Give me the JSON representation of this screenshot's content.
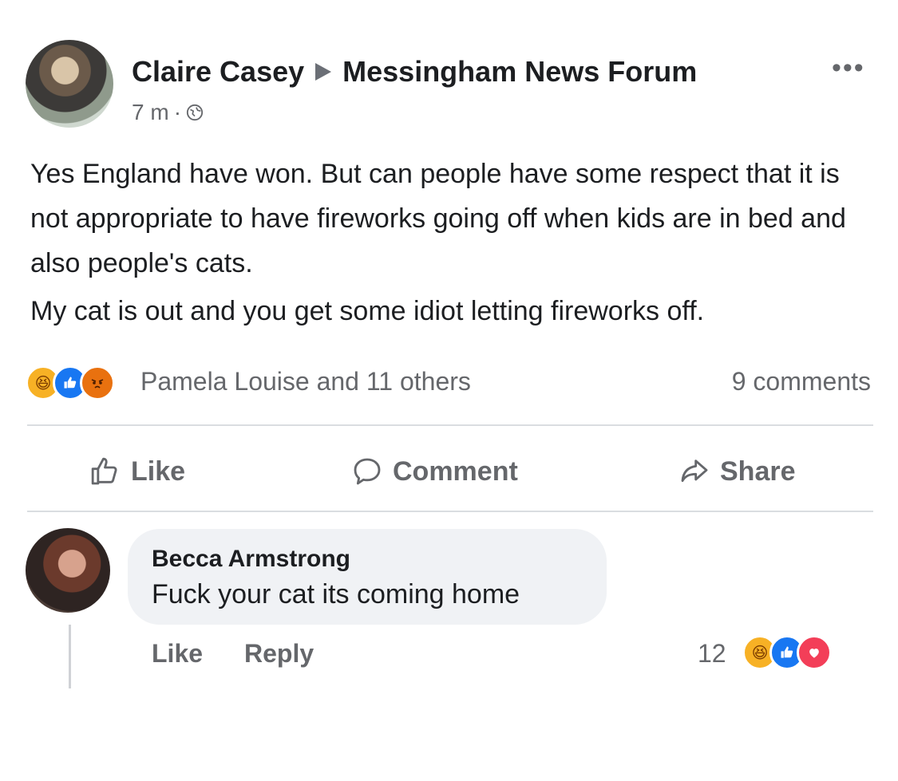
{
  "post": {
    "author": "Claire Casey",
    "group": "Messingham News Forum",
    "time": "7 m",
    "separator": "·",
    "more": "•••",
    "text_lines": [
      "Yes England have won. But can people have some respect that it is not appropriate to have fireworks going off when kids are in bed and also people's cats.",
      "My cat is out and you get some idiot letting fireworks off."
    ],
    "reactions": [
      "haha",
      "like",
      "angry"
    ],
    "reactors": "Pamela Louise and 11 others",
    "comments": "9 comments",
    "icons": {
      "audience": "globe-icon",
      "like": "thumbs-up-icon",
      "comment": "speech-bubble-icon",
      "share": "share-arrow-icon"
    }
  },
  "actions": {
    "like": "Like",
    "comment": "Comment",
    "share": "Share"
  },
  "comment": {
    "author": "Becca Armstrong",
    "text": "Fuck your cat its coming home",
    "like": "Like",
    "reply": "Reply",
    "reaction_count": "12",
    "reactions": [
      "haha",
      "like",
      "love"
    ]
  },
  "colors": {
    "text": "#1c1e21",
    "muted": "#65676b",
    "like_blue": "#1877f2",
    "bubble": "#f0f2f5"
  }
}
